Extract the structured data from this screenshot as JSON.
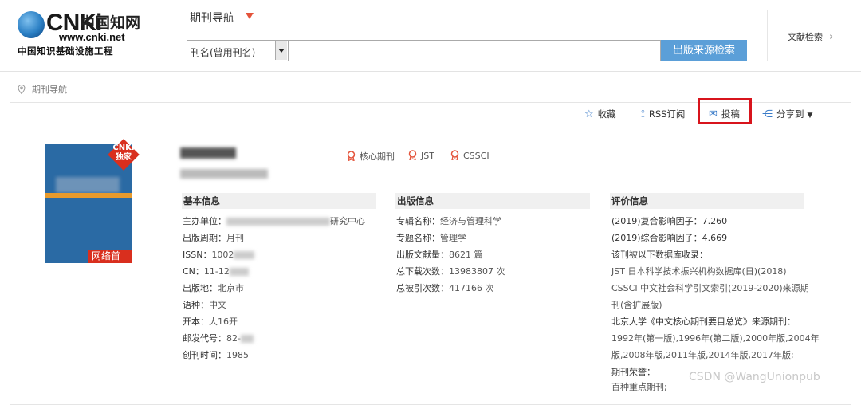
{
  "logo": {
    "brand": "CNKi",
    "brand_cn": "中国知网",
    "url": "www.cnki.net",
    "subtitle": "中国知识基础设施工程"
  },
  "header": {
    "nav_title": "期刊导航",
    "search_type": "刊名(曾用刊名)",
    "search_input_value": "",
    "search_button": "出版来源检索",
    "doc_search": "文献检索"
  },
  "breadcrumb": "期刊导航",
  "actions": {
    "favorite": "收藏",
    "rss": "RSS订阅",
    "submit": "投稿",
    "share": "分享到"
  },
  "cover": {
    "badge_top": "CNKI",
    "badge_bottom": "独家",
    "tag": "网络首发"
  },
  "badges": [
    "核心期刊",
    "JST",
    "CSSCI"
  ],
  "basic_info": {
    "heading": "基本信息",
    "rows": [
      {
        "label": "主办单位：",
        "value": "研究中心"
      },
      {
        "label": "出版周期：",
        "value": "月刊"
      },
      {
        "label": "ISSN：",
        "value": "1002"
      },
      {
        "label": "CN：",
        "value": "11-12"
      },
      {
        "label": "出版地：",
        "value": "北京市"
      },
      {
        "label": "语种：",
        "value": "中文"
      },
      {
        "label": "开本：",
        "value": "大16开"
      },
      {
        "label": "邮发代号：",
        "value": "82-"
      },
      {
        "label": "创刊时间：",
        "value": "1985"
      }
    ]
  },
  "publish_info": {
    "heading": "出版信息",
    "rows": [
      {
        "label": "专辑名称：",
        "value": "经济与管理科学"
      },
      {
        "label": "专题名称：",
        "value": "管理学"
      },
      {
        "label": "出版文献量：",
        "value": "8621 篇"
      },
      {
        "label": "总下载次数：",
        "value": "13983807 次"
      },
      {
        "label": "总被引次数：",
        "value": "417166 次"
      }
    ]
  },
  "eval_info": {
    "heading": "评价信息",
    "lines": [
      "(2019)复合影响因子：7.260",
      "(2019)综合影响因子：4.669",
      "该刊被以下数据库收录：",
      "JST 日本科学技术振兴机构数据库(日)(2018)",
      "CSSCI 中文社会科学引文索引(2019-2020)来源期",
      "刊(含扩展版)",
      "北京大学《中文核心期刊要目总览》来源期刊：",
      "1992年(第一版),1996年(第二版),2000年版,2004年",
      "版,2008年版,2011年版,2014年版,2017年版;",
      "期刊荣誉：",
      "百种重点期刊;"
    ]
  },
  "watermark": "CSDN @WangUnionpub"
}
